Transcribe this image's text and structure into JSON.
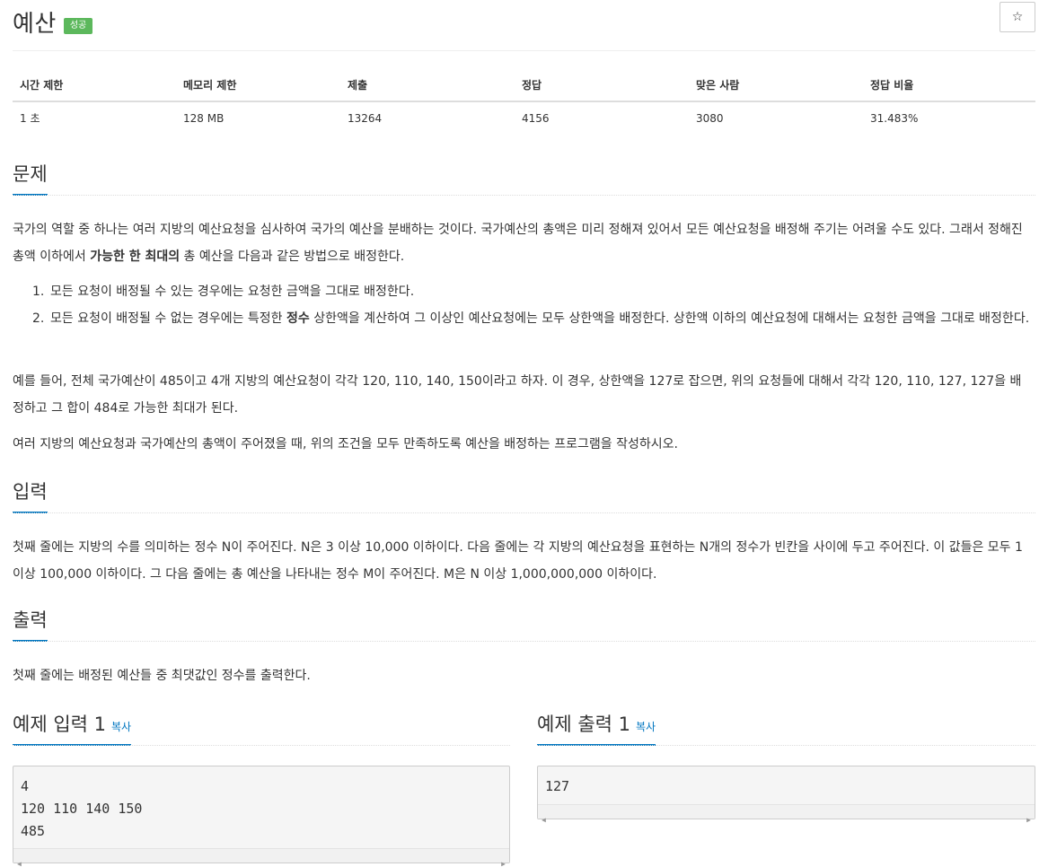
{
  "problem": {
    "title": "예산",
    "status_badge": "성공",
    "star_icon": "☆"
  },
  "info_table": {
    "headers": [
      "시간 제한",
      "메모리 제한",
      "제출",
      "정답",
      "맞은 사람",
      "정답 비율"
    ],
    "values": [
      "1 초",
      "128 MB",
      "13264",
      "4156",
      "3080",
      "31.483%"
    ]
  },
  "sections": {
    "description": {
      "title": "문제",
      "p1_part1": "국가의 역할 중 하나는 여러 지방의 예산요청을 심사하여 국가의 예산을 분배하는 것이다. 국가예산의 총액은 미리 정해져 있어서 모든 예산요청을 배정해 주기는 어려울 수도 있다. 그래서 정해진 총액 이하에서 ",
      "p1_bold": "가능한 한 최대의",
      "p1_part2": " 총 예산을 다음과 같은 방법으로 배정한다.",
      "list": [
        {
          "num": "1.",
          "text": "모든 요청이 배정될 수 있는 경우에는 요청한 금액을 그대로 배정한다."
        },
        {
          "num": "2.",
          "text_part1": "모든 요청이 배정될 수 없는 경우에는 특정한 ",
          "text_bold": "정수",
          "text_part2": " 상한액을 계산하여 그 이상인 예산요청에는 모두 상한액을 배정한다. 상한액 이하의 예산요청에 대해서는 요청한 금액을 그대로 배정한다."
        }
      ],
      "p2": "예를 들어, 전체 국가예산이 485이고 4개 지방의 예산요청이 각각 120, 110, 140, 150이라고 하자. 이 경우, 상한액을 127로 잡으면, 위의 요청들에 대해서 각각 120, 110, 127, 127을 배정하고 그 합이 484로 가능한 최대가 된다.",
      "p3": "여러 지방의 예산요청과 국가예산의 총액이 주어졌을 때, 위의 조건을 모두 만족하도록 예산을 배정하는 프로그램을 작성하시오."
    },
    "input": {
      "title": "입력",
      "text": "첫째 줄에는 지방의 수를 의미하는 정수 N이 주어진다. N은 3 이상 10,000 이하이다. 다음 줄에는 각 지방의 예산요청을 표현하는 N개의 정수가 빈칸을 사이에 두고 주어진다. 이 값들은 모두 1 이상 100,000 이하이다. 그 다음 줄에는 총 예산을 나타내는 정수 M이 주어진다. M은 N 이상 1,000,000,000 이하이다."
    },
    "output": {
      "title": "출력",
      "text": "첫째 줄에는 배정된 예산들 중 최댓값인 정수를 출력한다."
    }
  },
  "samples": {
    "input": {
      "title": "예제 입력 1",
      "copy_label": "복사",
      "content": "4\n120 110 140 150\n485"
    },
    "output": {
      "title": "예제 출력 1",
      "copy_label": "복사",
      "content": "127"
    }
  },
  "colors": {
    "accent": "#0076c0",
    "success": "#5cb85c"
  }
}
